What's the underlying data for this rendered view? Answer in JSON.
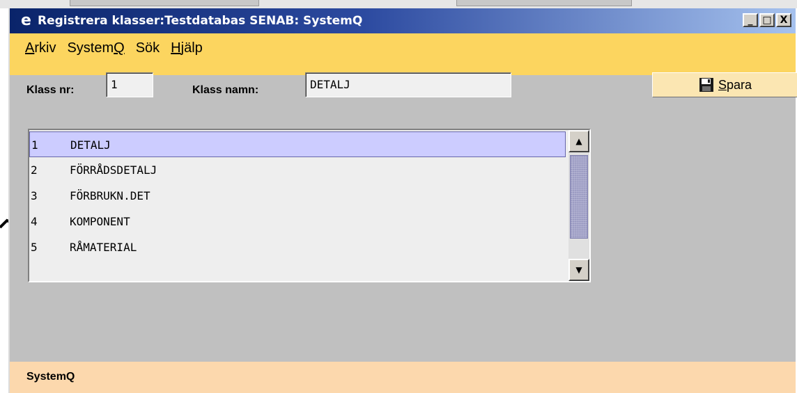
{
  "window": {
    "title": "Registrera klasser:Testdatabas SENAB: SystemQ",
    "icon": "e-app-icon",
    "buttons": {
      "minimize": "_",
      "maximize": "□",
      "close": "X"
    }
  },
  "menu": [
    {
      "pre": "",
      "key": "A",
      "post": "rkiv"
    },
    {
      "pre": "System",
      "key": "Q",
      "post": ""
    },
    {
      "pre": "Sök",
      "key": "",
      "post": ""
    },
    {
      "pre": "",
      "key": "H",
      "post": "jälp"
    }
  ],
  "form": {
    "klass_nr_label": "Klass nr:",
    "klass_nr_value": "1",
    "klass_namn_label": "Klass namn:",
    "klass_namn_value": "DETALJ",
    "save_pre": "",
    "save_key": "S",
    "save_post": "para",
    "save_icon": "floppy-disk-icon"
  },
  "list": {
    "items": [
      {
        "nr": "1",
        "name": "DETALJ"
      },
      {
        "nr": "2",
        "name": "FÖRRÅDSDETALJ"
      },
      {
        "nr": "3",
        "name": "FÖRBRUKN.DET"
      },
      {
        "nr": "4",
        "name": "KOMPONENT"
      },
      {
        "nr": "5",
        "name": "RÅMATERIAL"
      }
    ],
    "selected_index": 0
  },
  "status": {
    "text": "SystemQ"
  },
  "colors": {
    "menubar": "#fcd55f",
    "statusbar": "#fcd8ad",
    "selection": "#ccccff",
    "titlebar_start": "#0a246a"
  }
}
